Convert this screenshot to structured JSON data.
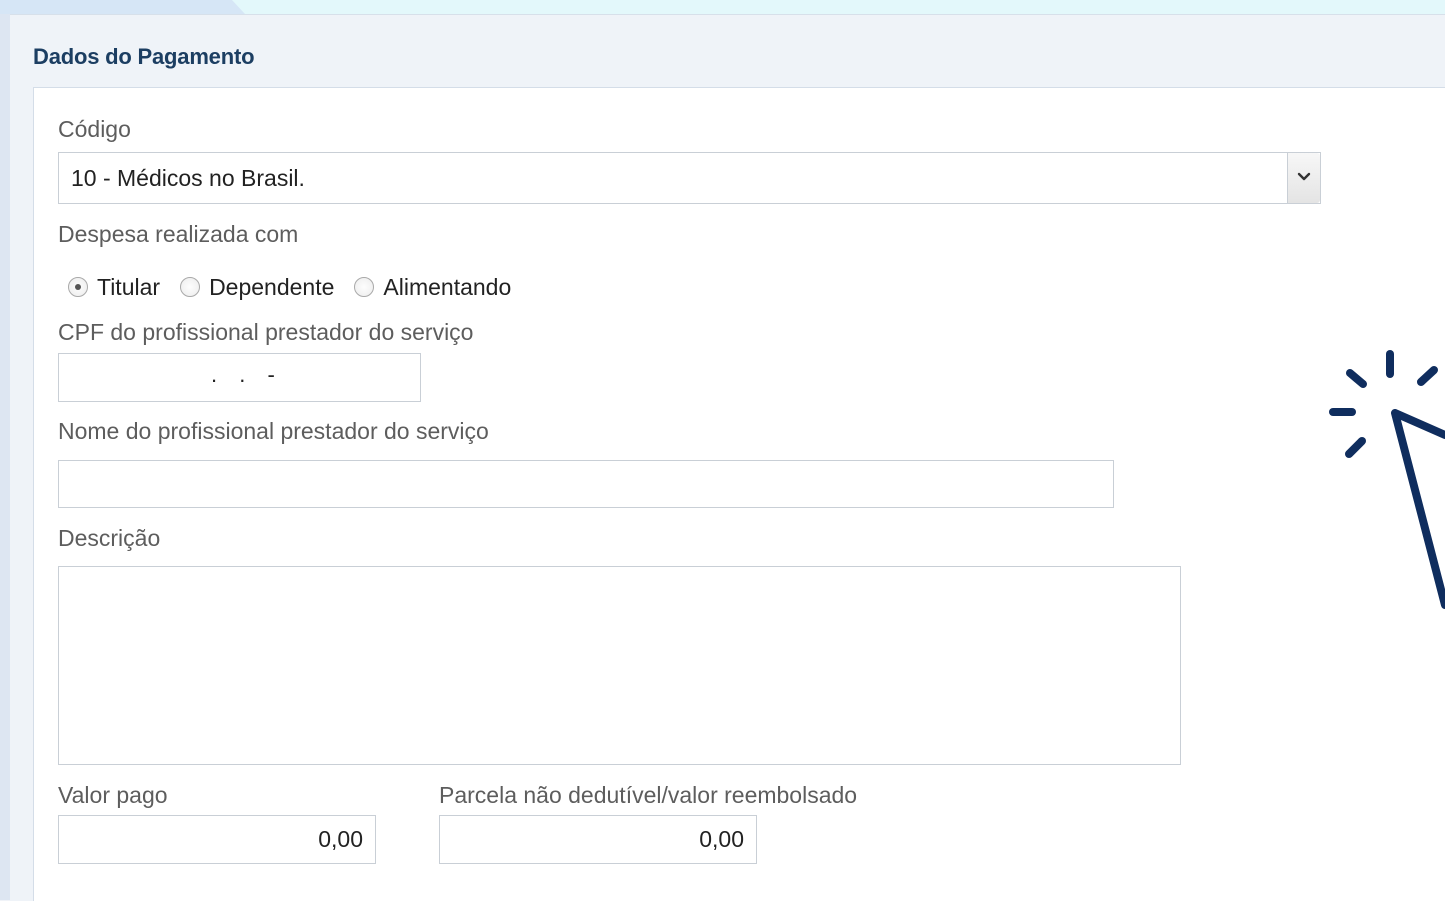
{
  "section": {
    "title": "Dados do Pagamento"
  },
  "codigo": {
    "label": "Código",
    "selected": "10 - Médicos no Brasil."
  },
  "despesa": {
    "label": "Despesa realizada com",
    "options": [
      "Titular",
      "Dependente",
      "Alimentando"
    ],
    "selected": "Titular"
  },
  "cpf": {
    "label": "CPF do profissional prestador do serviço",
    "mask": ". . -"
  },
  "nome": {
    "label": "Nome do profissional prestador do serviço",
    "value": ""
  },
  "descricao": {
    "label": "Descrição",
    "value": ""
  },
  "valor_pago": {
    "label": "Valor pago",
    "value": "0,00"
  },
  "parcela": {
    "label": "Parcela não dedutível/valor reembolsado",
    "value": "0,00"
  },
  "icons": {
    "select_arrow": "chevron-down-icon",
    "decoration": "click-cursor-icon"
  },
  "colors": {
    "title": "#1c3e62",
    "cursor_graphic": "#0f2d5e",
    "panel_bg": "#eff3f8",
    "top_band": "#e3f8fb"
  }
}
